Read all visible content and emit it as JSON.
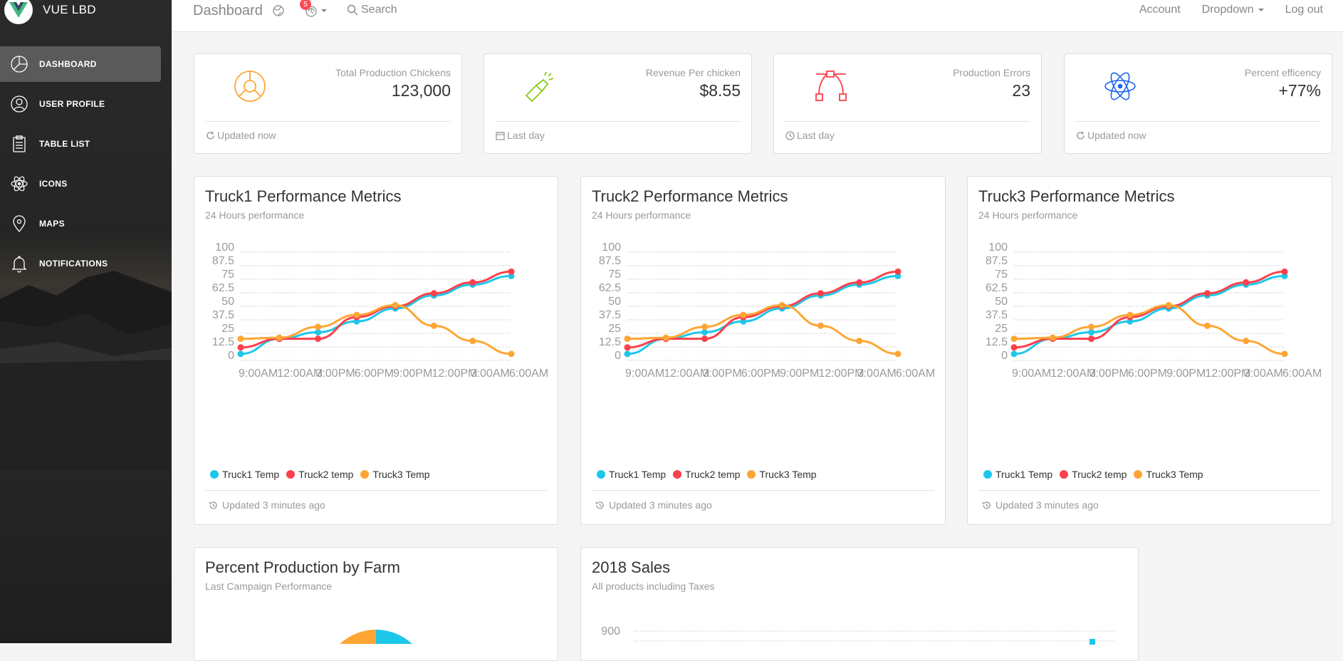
{
  "brand": {
    "title": "VUE LBD"
  },
  "sidebar": {
    "items": [
      {
        "label": "DASHBOARD",
        "icon": "chart-pie-icon",
        "active": true
      },
      {
        "label": "USER PROFILE",
        "icon": "user-icon",
        "active": false
      },
      {
        "label": "TABLE LIST",
        "icon": "clipboard-icon",
        "active": false
      },
      {
        "label": "ICONS",
        "icon": "atom-icon",
        "active": false
      },
      {
        "label": "MAPS",
        "icon": "map-pin-icon",
        "active": false
      },
      {
        "label": "NOTIFICATIONS",
        "icon": "bell-icon",
        "active": false
      }
    ]
  },
  "topbar": {
    "page_title": "Dashboard",
    "notification_count": "5",
    "search_label": "Search",
    "account_label": "Account",
    "dropdown_label": "Dropdown",
    "logout_label": "Log out"
  },
  "stats": [
    {
      "label": "Total Production Chickens",
      "value": "123,000",
      "footer": "Updated now",
      "icon": "chart-pie-icon",
      "icon_color": "#ffa534",
      "footer_icon": "refresh-icon"
    },
    {
      "label": "Revenue Per chicken",
      "value": "$8.55",
      "footer": "Last day",
      "icon": "flashlight-icon",
      "icon_color": "#87cb16",
      "footer_icon": "calendar-icon"
    },
    {
      "label": "Production Errors",
      "value": "23",
      "footer": "Last day",
      "icon": "vector-icon",
      "icon_color": "#fb404b",
      "footer_icon": "clock-icon"
    },
    {
      "label": "Percent efficency",
      "value": "+77%",
      "footer": "Updated now",
      "icon": "atom-icon",
      "icon_color": "#1d62f0",
      "footer_icon": "refresh-icon"
    }
  ],
  "trucks": [
    {
      "title": "Truck1 Performance Metrics",
      "subtitle": "24 Hours performance",
      "footer": "Updated 3 minutes ago"
    },
    {
      "title": "Truck2 Performance Metrics",
      "subtitle": "24 Hours performance",
      "footer": "Updated 3 minutes ago"
    },
    {
      "title": "Truck3 Performance Metrics",
      "subtitle": "24 Hours performance",
      "footer": "Updated 3 minutes ago"
    }
  ],
  "farm_card": {
    "title": "Percent Production by Farm",
    "subtitle": "Last Campaign Performance"
  },
  "sales_card": {
    "title": "2018 Sales",
    "subtitle": "All products including Taxes",
    "visible_tick": "900"
  },
  "colors": {
    "truck1": "#1dc7ea",
    "truck2": "#fb404b",
    "truck3": "#ffa534",
    "active_nav": "rgba(255,255,255,0.23)"
  },
  "chart_data": [
    {
      "type": "line",
      "title": "Truck1 Performance Metrics",
      "categories": [
        "9:00AM",
        "12:00AM",
        "3:00PM",
        "6:00PM",
        "9:00PM",
        "12:00PM",
        "3:00AM",
        "6:00AM"
      ],
      "y_ticks": [
        "100",
        "87.5",
        "75",
        "62.5",
        "50",
        "37.5",
        "25",
        "12.5",
        "0"
      ],
      "ylim": [
        0,
        100
      ],
      "grid": true,
      "legend": "bottom-left",
      "series": [
        {
          "name": "Truck1 Temp",
          "color": "#1dc7ea",
          "values": [
            6,
            20,
            26,
            36,
            48,
            60,
            70,
            78
          ]
        },
        {
          "name": "Truck2 temp",
          "color": "#fb404b",
          "values": [
            12,
            20,
            20,
            40,
            50,
            62,
            72,
            82
          ]
        },
        {
          "name": "Truck3 Temp",
          "color": "#ffa534",
          "values": [
            20,
            21,
            31,
            42,
            51,
            32,
            18,
            6
          ]
        }
      ]
    },
    {
      "type": "line",
      "title": "Truck2 Performance Metrics",
      "categories": [
        "9:00AM",
        "12:00AM",
        "3:00PM",
        "6:00PM",
        "9:00PM",
        "12:00PM",
        "3:00AM",
        "6:00AM"
      ],
      "y_ticks": [
        "100",
        "87.5",
        "75",
        "62.5",
        "50",
        "37.5",
        "25",
        "12.5",
        "0"
      ],
      "ylim": [
        0,
        100
      ],
      "grid": true,
      "legend": "bottom-left",
      "series": [
        {
          "name": "Truck1 Temp",
          "color": "#1dc7ea",
          "values": [
            6,
            20,
            26,
            36,
            48,
            60,
            70,
            78
          ]
        },
        {
          "name": "Truck2 temp",
          "color": "#fb404b",
          "values": [
            12,
            20,
            20,
            40,
            50,
            62,
            72,
            82
          ]
        },
        {
          "name": "Truck3 Temp",
          "color": "#ffa534",
          "values": [
            20,
            21,
            31,
            42,
            51,
            32,
            18,
            6
          ]
        }
      ]
    },
    {
      "type": "line",
      "title": "Truck3 Performance Metrics",
      "categories": [
        "9:00AM",
        "12:00AM",
        "3:00PM",
        "6:00PM",
        "9:00PM",
        "12:00PM",
        "3:00AM",
        "6:00AM"
      ],
      "y_ticks": [
        "100",
        "87.5",
        "75",
        "62.5",
        "50",
        "37.5",
        "25",
        "12.5",
        "0"
      ],
      "ylim": [
        0,
        100
      ],
      "grid": true,
      "legend": "bottom-left",
      "series": [
        {
          "name": "Truck1 Temp",
          "color": "#1dc7ea",
          "values": [
            6,
            20,
            26,
            36,
            48,
            60,
            70,
            78
          ]
        },
        {
          "name": "Truck2 temp",
          "color": "#fb404b",
          "values": [
            12,
            20,
            20,
            40,
            50,
            62,
            72,
            82
          ]
        },
        {
          "name": "Truck3 Temp",
          "color": "#ffa534",
          "values": [
            20,
            21,
            31,
            42,
            51,
            32,
            18,
            6
          ]
        }
      ]
    }
  ]
}
